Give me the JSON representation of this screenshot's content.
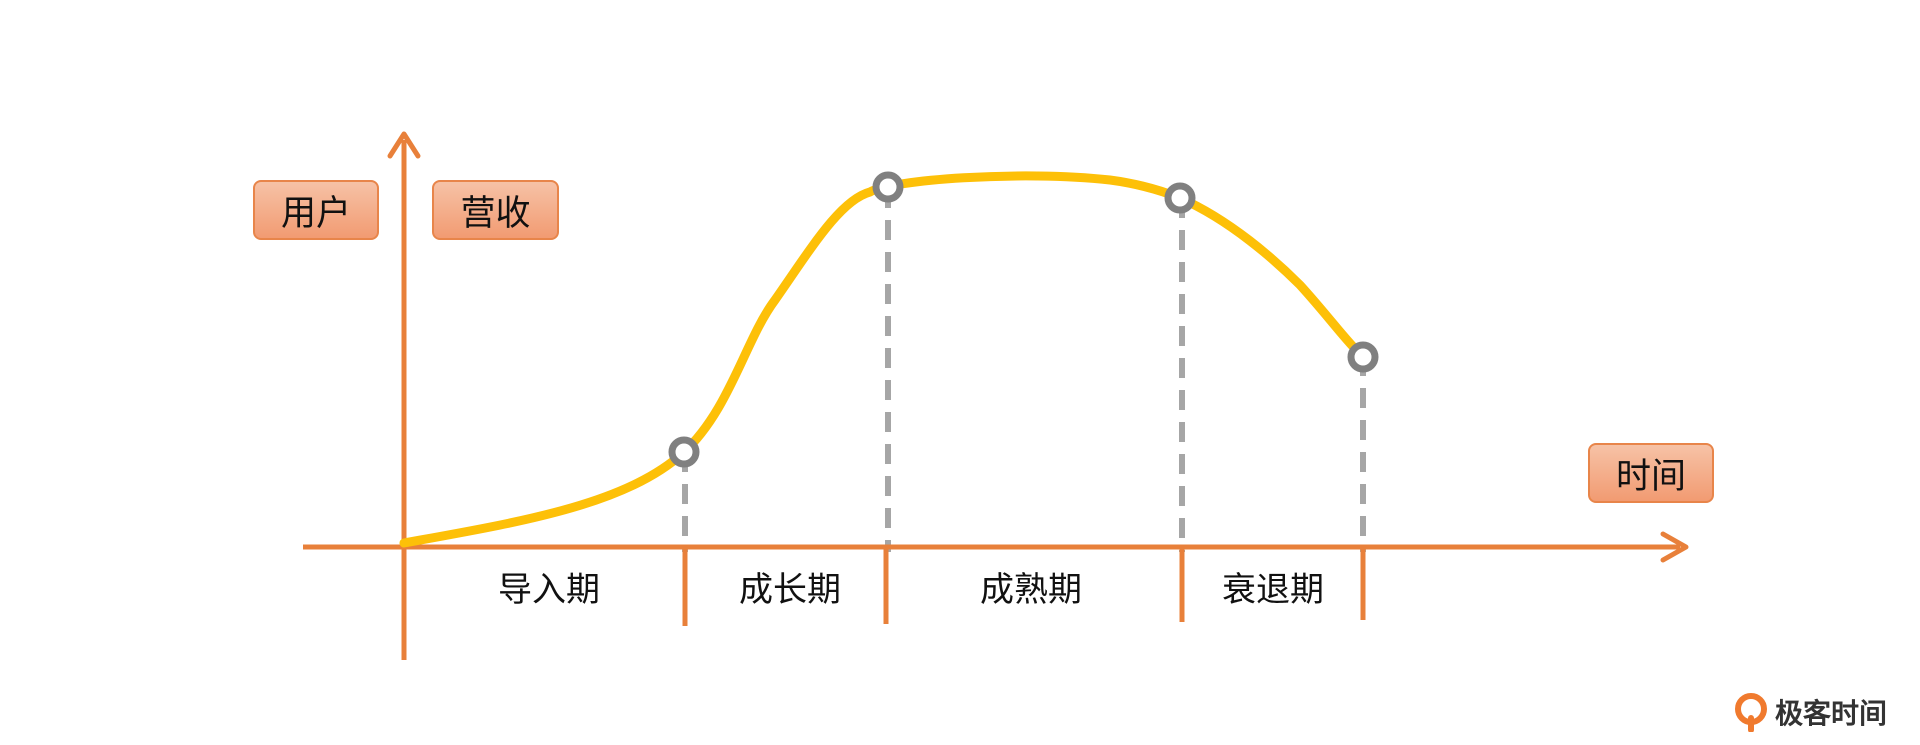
{
  "tags": {
    "user": "用户",
    "revenue": "营收",
    "time": "时间"
  },
  "stages": [
    "导入期",
    "成长期",
    "成熟期",
    "衰退期"
  ],
  "logo": {
    "text": "极客时间",
    "icon": "geektime-logo-icon"
  },
  "colors": {
    "axis": "#E8803A",
    "curve": "#FDC008",
    "marker": "#808080",
    "dash": "#A6A6A6",
    "tag_fill": "#F29B72",
    "tag_border": "#E8854A"
  }
}
